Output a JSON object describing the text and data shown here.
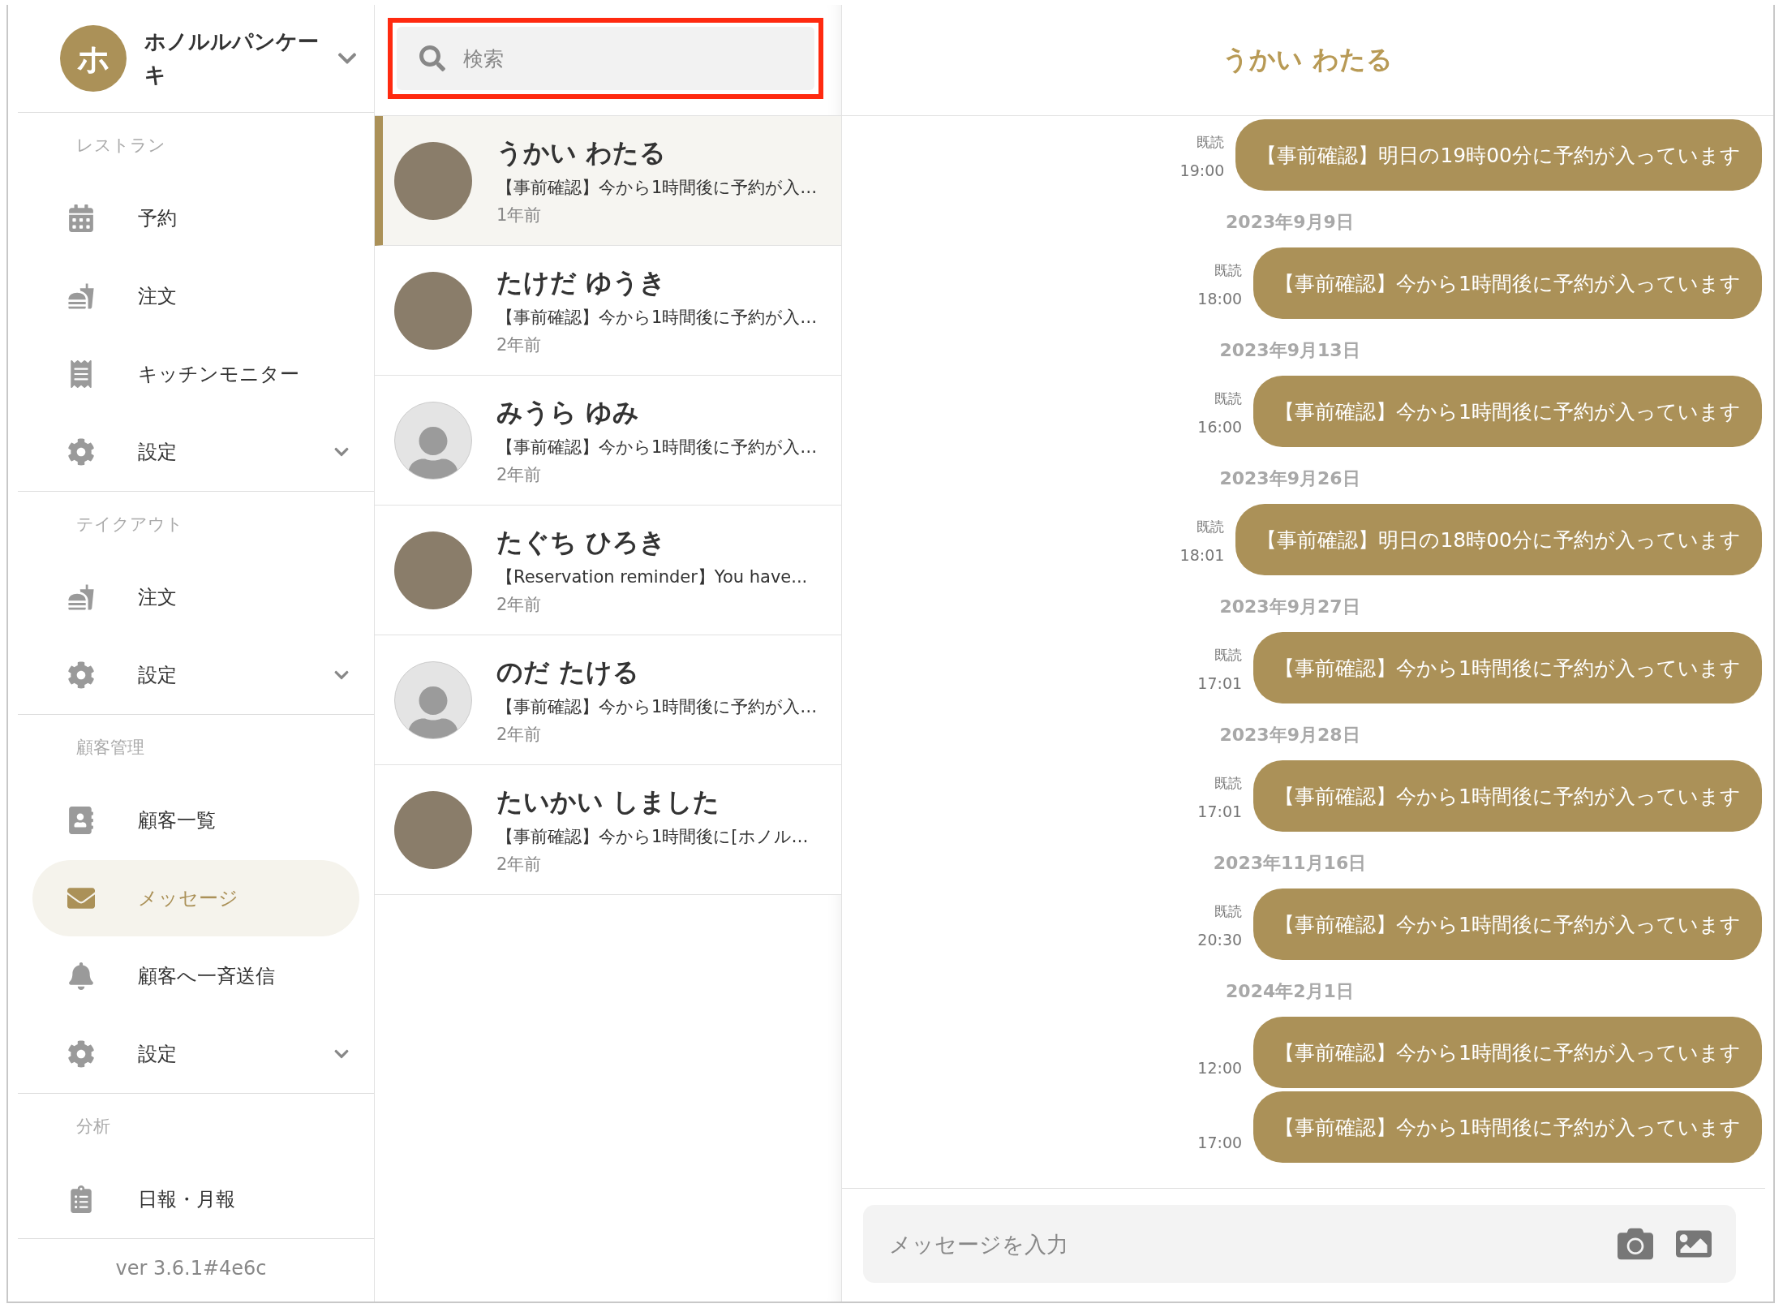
{
  "sidebar": {
    "store": {
      "initial": "ホ",
      "name": "ホノルルパンケーキ",
      "expanded": false
    },
    "sections": [
      {
        "label": "レストラン",
        "items": [
          {
            "kind": "calendar",
            "label": "予約",
            "selected": false
          },
          {
            "kind": "food",
            "label": "注文",
            "selected": false
          },
          {
            "kind": "receipt",
            "label": "キッチンモニター",
            "selected": false
          },
          {
            "kind": "gear",
            "label": "設定",
            "selected": false,
            "expanded": false
          }
        ]
      },
      {
        "label": "テイクアウト",
        "items": [
          {
            "kind": "food",
            "label": "注文",
            "selected": false
          },
          {
            "kind": "gear",
            "label": "設定",
            "selected": false,
            "expanded": false
          }
        ]
      },
      {
        "label": "顧客管理",
        "items": [
          {
            "kind": "contacts",
            "label": "顧客一覧",
            "selected": false
          },
          {
            "kind": "mail",
            "label": "メッセージ",
            "selected": true
          },
          {
            "kind": "bell",
            "label": "顧客へ一斉送信",
            "selected": false
          },
          {
            "kind": "gear",
            "label": "設定",
            "selected": false,
            "expanded": false
          }
        ]
      },
      {
        "label": "分析",
        "items": [
          {
            "kind": "clipboard",
            "label": "日報・月報",
            "selected": false
          }
        ]
      }
    ],
    "version": "ver 3.6.1#4e6c"
  },
  "conversations": {
    "search": {
      "placeholder": "検索",
      "highlighted": true
    },
    "items": [
      {
        "kind": "photo",
        "name": "うかい わたる",
        "preview": "【事前確認】今から1時間後に予約が入…",
        "time": "1年前",
        "selected": true
      },
      {
        "kind": "photo",
        "name": "たけだ ゆうき",
        "preview": "【事前確認】今から1時間後に予約が入…",
        "time": "2年前",
        "selected": false
      },
      {
        "kind": "default",
        "name": "みうら ゆみ",
        "preview": "【事前確認】今から1時間後に予約が入…",
        "time": "2年前",
        "selected": false
      },
      {
        "kind": "photo",
        "name": "たぐち ひろき",
        "preview": "【Reservation reminder】You have...",
        "time": "2年前",
        "selected": false
      },
      {
        "kind": "default",
        "name": "のだ たける",
        "preview": "【事前確認】今から1時間後に予約が入…",
        "time": "2年前",
        "selected": false
      },
      {
        "kind": "photo",
        "name": "たいかい しました",
        "preview": "【事前確認】今から1時間後に[ホノル…",
        "time": "2年前",
        "selected": false
      }
    ]
  },
  "chat": {
    "title": "うかい わたる",
    "messages": [
      {
        "kind": "message",
        "read": "既読",
        "time": "19:00",
        "text": "【事前確認】明日の19時00分に予約が入っています"
      },
      {
        "kind": "date",
        "text": "2023年9月9日"
      },
      {
        "kind": "message",
        "read": "既読",
        "time": "18:00",
        "text": "【事前確認】今から1時間後に予約が入っています"
      },
      {
        "kind": "date",
        "text": "2023年9月13日"
      },
      {
        "kind": "message",
        "read": "既読",
        "time": "16:00",
        "text": "【事前確認】今から1時間後に予約が入っています"
      },
      {
        "kind": "date",
        "text": "2023年9月26日"
      },
      {
        "kind": "message",
        "read": "既読",
        "time": "18:01",
        "text": "【事前確認】明日の18時00分に予約が入っています"
      },
      {
        "kind": "date",
        "text": "2023年9月27日"
      },
      {
        "kind": "message",
        "read": "既読",
        "time": "17:01",
        "text": "【事前確認】今から1時間後に予約が入っています"
      },
      {
        "kind": "date",
        "text": "2023年9月28日"
      },
      {
        "kind": "message",
        "read": "既読",
        "time": "17:01",
        "text": "【事前確認】今から1時間後に予約が入っています"
      },
      {
        "kind": "date",
        "text": "2023年11月16日"
      },
      {
        "kind": "message",
        "read": "既読",
        "time": "20:30",
        "text": "【事前確認】今から1時間後に予約が入っています"
      },
      {
        "kind": "date",
        "text": "2024年2月1日"
      },
      {
        "kind": "message",
        "time": "12:00",
        "text": "【事前確認】今から1時間後に予約が入っています"
      },
      {
        "kind": "message",
        "time": "17:00",
        "text": "【事前確認】今から1時間後に予約が入っています"
      }
    ],
    "input": {
      "placeholder": "メッセージを入力"
    }
  }
}
